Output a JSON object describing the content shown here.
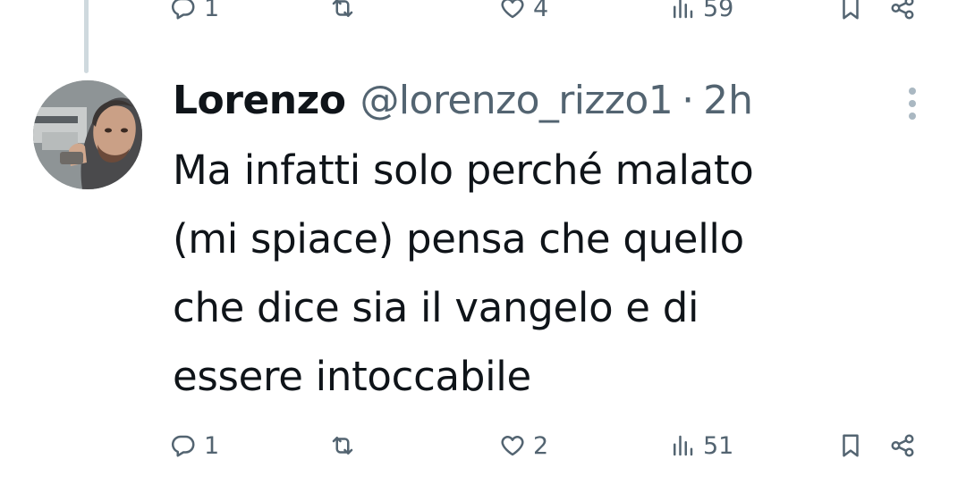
{
  "previous_tweet": {
    "actions": {
      "replies": "1",
      "reposts": "",
      "likes": "4",
      "views": "59"
    }
  },
  "tweet": {
    "display_name": "Lorenzo",
    "handle": "@lorenzo_rizzo1",
    "separator": "·",
    "time": "2h",
    "text_lines": [
      "Ma infatti solo perché malato",
      "(mi spiace) pensa che quello",
      "che dice sia il vangelo e di",
      "essere intoccabile"
    ],
    "actions": {
      "replies": "1",
      "reposts": "",
      "likes": "2",
      "views": "51"
    }
  },
  "icons": {
    "reply": "reply-icon",
    "repost": "repost-icon",
    "like": "heart-icon",
    "views": "views-icon",
    "bookmark": "bookmark-icon",
    "share": "share-icon",
    "more": "more-vertical-icon"
  },
  "colors": {
    "text_primary": "#0f1419",
    "text_secondary": "#536471",
    "thread_line": "#cfd9de",
    "background": "#ffffff"
  }
}
